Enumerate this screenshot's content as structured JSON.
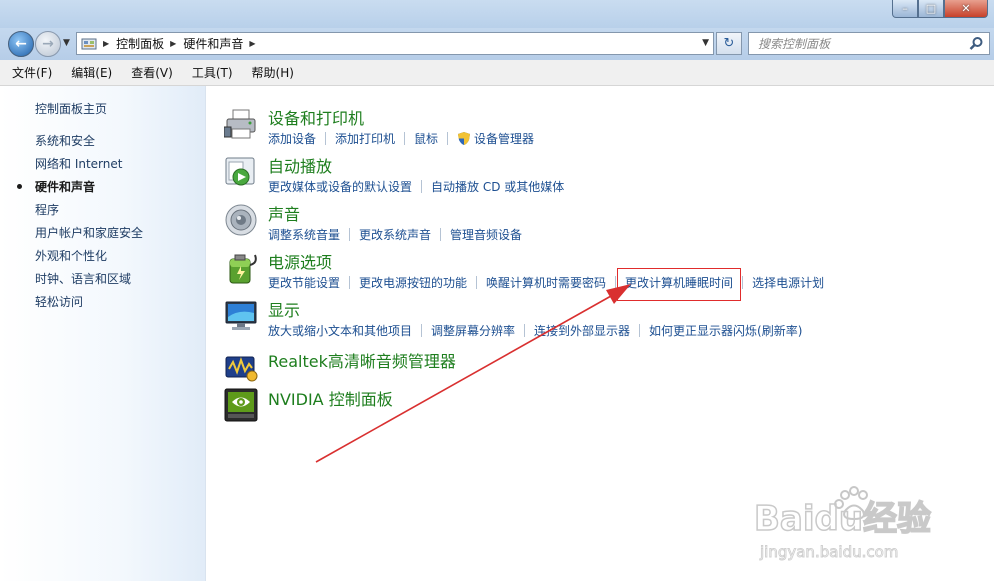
{
  "window": {
    "min": "–",
    "max": "□",
    "close": "✕"
  },
  "breadcrumb": [
    "控制面板",
    "硬件和声音"
  ],
  "search": {
    "placeholder": "搜索控制面板"
  },
  "menu": [
    "文件(F)",
    "编辑(E)",
    "查看(V)",
    "工具(T)",
    "帮助(H)"
  ],
  "sidebar": {
    "home": "控制面板主页",
    "items": [
      "系统和安全",
      "网络和 Internet",
      "硬件和声音",
      "程序",
      "用户帐户和家庭安全",
      "外观和个性化",
      "时钟、语言和区域",
      "轻松访问"
    ],
    "active_index": 2
  },
  "categories": [
    {
      "title": "设备和打印机",
      "icon": "printer-icon",
      "links": [
        "添加设备",
        "添加打印机",
        "鼠标",
        "设备管理器"
      ]
    },
    {
      "title": "自动播放",
      "icon": "autoplay-icon",
      "links": [
        "更改媒体或设备的默认设置",
        "自动播放 CD 或其他媒体"
      ]
    },
    {
      "title": "声音",
      "icon": "speaker-icon",
      "links": [
        "调整系统音量",
        "更改系统声音",
        "管理音频设备"
      ]
    },
    {
      "title": "电源选项",
      "icon": "power-icon",
      "links": [
        "更改节能设置",
        "更改电源按钮的功能",
        "唤醒计算机时需要密码",
        "更改计算机睡眠时间",
        "选择电源计划"
      ],
      "highlighted_link_index": 3
    },
    {
      "title": "显示",
      "icon": "display-icon",
      "links": [
        "放大或缩小文本和其他项目",
        "调整屏幕分辨率",
        "连接到外部显示器",
        "如何更正显示器闪烁(刷新率)"
      ]
    },
    {
      "title": "Realtek高清晰音频管理器",
      "icon": "realtek-audio-icon",
      "links": []
    },
    {
      "title": "NVIDIA 控制面板",
      "icon": "nvidia-icon",
      "links": []
    }
  ],
  "annotation": {
    "arrow_color": "#d93030",
    "box_color": "#e02c2c"
  },
  "watermark": {
    "brand": "Baidu经验",
    "url": "jingyan.baidu.com"
  }
}
